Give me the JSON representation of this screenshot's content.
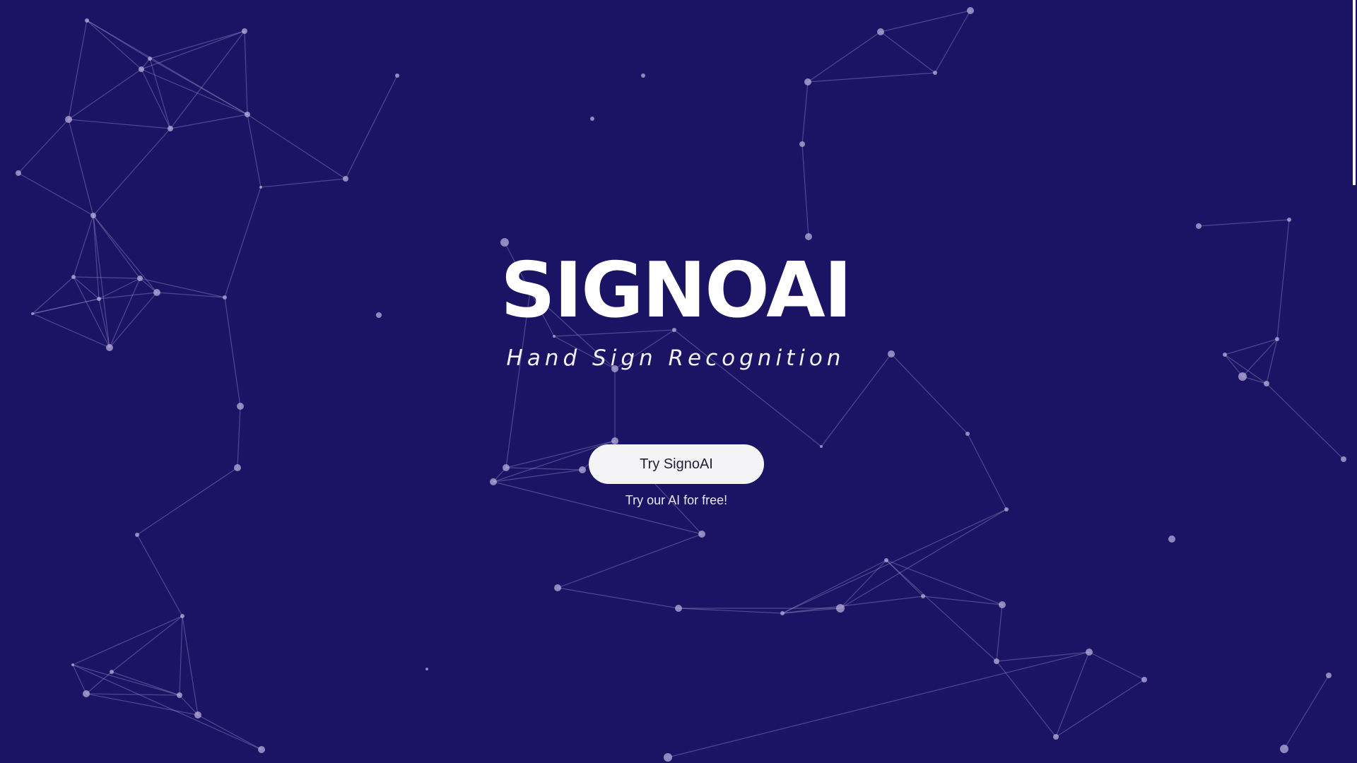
{
  "hero": {
    "title": "SIGNOAI",
    "subtitle": "Hand Sign Recognition",
    "cta_label": "Try SignoAI",
    "cta_caption": "Try our AI for free!"
  },
  "colors": {
    "background": "#1b1464",
    "text": "#ffffff",
    "button_bg": "#f4f4f6",
    "button_text": "#1f1f3a",
    "network": "#b4aadc"
  }
}
